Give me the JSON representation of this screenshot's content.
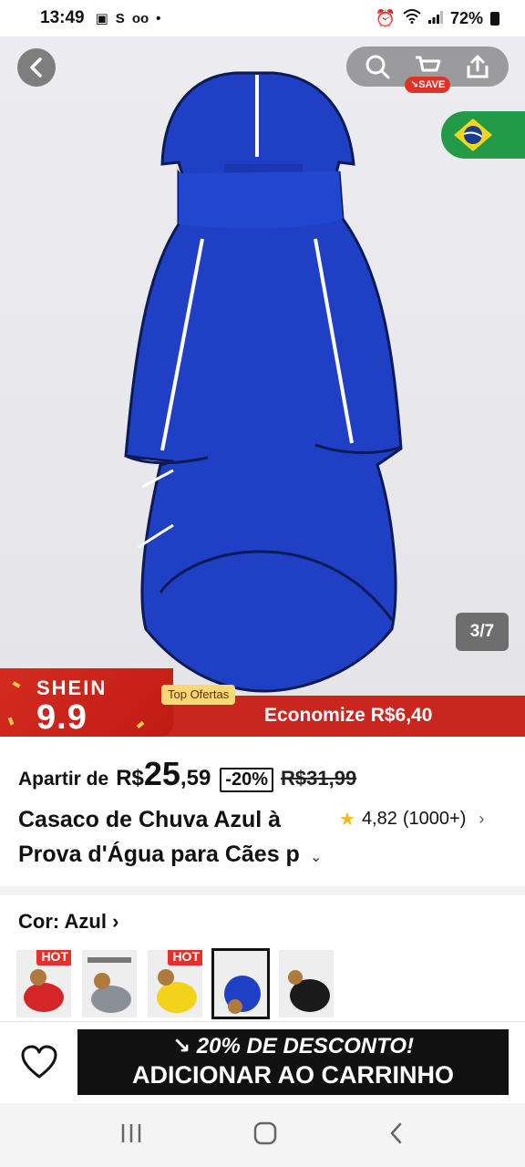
{
  "status_bar": {
    "time": "13:49",
    "battery": "72%"
  },
  "gallery": {
    "counter": "3/7",
    "save_badge": "SAVE"
  },
  "promo": {
    "brand": "SHEIN",
    "sale_number": "9.9",
    "tag": "Top Ofertas",
    "savings": "Economize R$6,40"
  },
  "price": {
    "prefix": "Apartir de",
    "currency": "R$",
    "integer": "25",
    "decimal": ",59",
    "discount": "-20%",
    "original": "R$31,99"
  },
  "product": {
    "title": "Casaco de Chuva Azul à Prova d'Água para Cães p",
    "rating": "4,82",
    "reviews": "(1000+)"
  },
  "color": {
    "label": "Cor: Azul",
    "swatches": [
      {
        "name": "red",
        "hot": "HOT"
      },
      {
        "name": "grey",
        "hot": ""
      },
      {
        "name": "yellow",
        "hot": "HOT"
      },
      {
        "name": "blue",
        "hot": ""
      },
      {
        "name": "black",
        "hot": ""
      }
    ]
  },
  "actions": {
    "discount_line": "20% DE DESCONTO!",
    "cart_line": "ADICIONAR AO CARRINHO"
  },
  "colors": {
    "accent_red": "#e0322b",
    "coat_blue": "#1f3fc4",
    "button_black": "#111111"
  }
}
